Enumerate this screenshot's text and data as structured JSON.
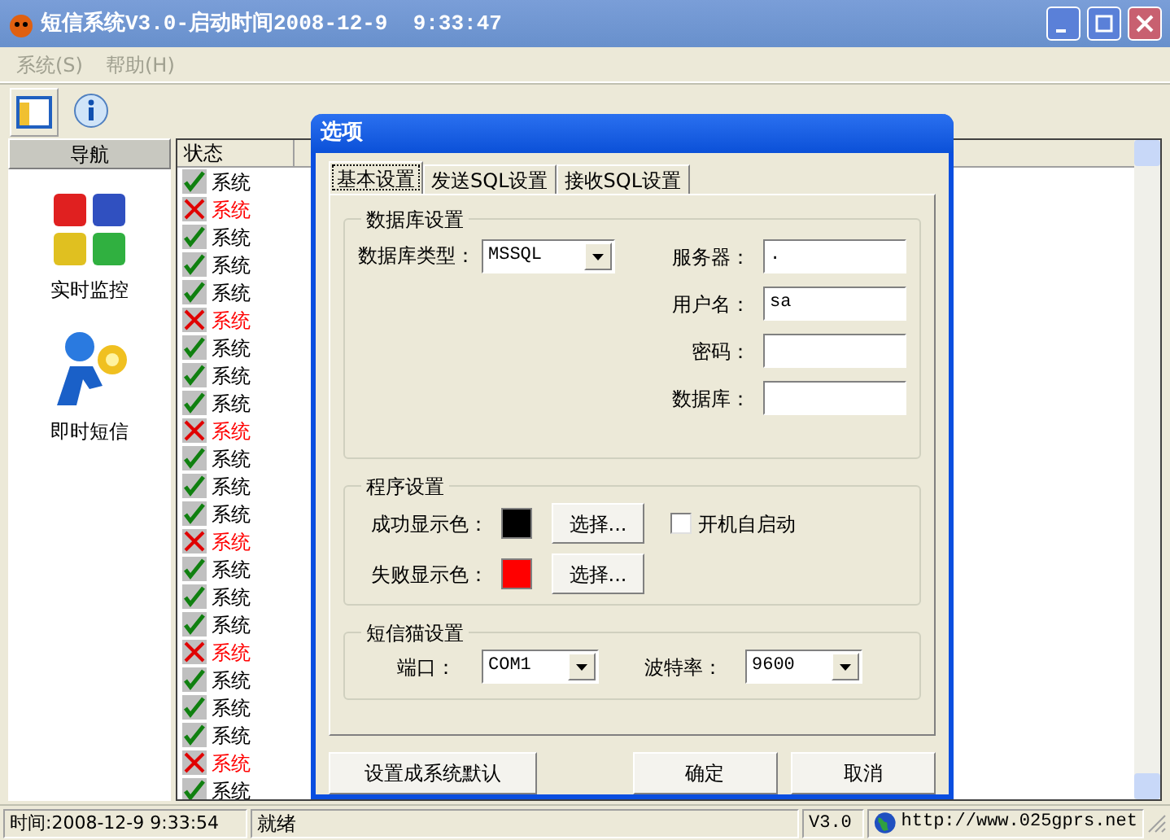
{
  "window": {
    "title": "短信系统V3.0-启动时间2008-12-9  9:33:47"
  },
  "menu": [
    {
      "label": "系统(S)",
      "disabled": true
    },
    {
      "label": "帮助(H)",
      "disabled": true
    }
  ],
  "nav": {
    "title": "导航",
    "items": [
      {
        "label": "实时监控",
        "kind": "monitor"
      },
      {
        "label": "即时短信",
        "kind": "message"
      }
    ]
  },
  "log": {
    "columns": [
      "状态"
    ],
    "rows": [
      {
        "failed": false,
        "text": "系统"
      },
      {
        "failed": true,
        "text": "系统"
      },
      {
        "failed": false,
        "text": "系统"
      },
      {
        "failed": false,
        "text": "系统"
      },
      {
        "failed": false,
        "text": "系统"
      },
      {
        "failed": true,
        "text": "系统"
      },
      {
        "failed": false,
        "text": "系统"
      },
      {
        "failed": false,
        "text": "系统"
      },
      {
        "failed": false,
        "text": "系统"
      },
      {
        "failed": true,
        "text": "系统"
      },
      {
        "failed": false,
        "text": "系统"
      },
      {
        "failed": false,
        "text": "系统"
      },
      {
        "failed": false,
        "text": "系统"
      },
      {
        "failed": true,
        "text": "系统"
      },
      {
        "failed": false,
        "text": "系统"
      },
      {
        "failed": false,
        "text": "系统"
      },
      {
        "failed": false,
        "text": "系统"
      },
      {
        "failed": true,
        "text": "系统"
      },
      {
        "failed": false,
        "text": "系统"
      },
      {
        "failed": false,
        "text": "系统"
      },
      {
        "failed": false,
        "text": "系统"
      },
      {
        "failed": true,
        "text": "系统"
      },
      {
        "failed": false,
        "text": "系统"
      }
    ]
  },
  "dialog": {
    "title": "选项",
    "tabs": [
      {
        "label": "基本设置",
        "selected": true
      },
      {
        "label": "发送SQL设置",
        "selected": false
      },
      {
        "label": "接收SQL设置",
        "selected": false
      }
    ],
    "database": {
      "title": "数据库设置",
      "type_label": "数据库类型：",
      "type_value": "MSSQL",
      "fields": [
        {
          "label": "服务器：",
          "value": "."
        },
        {
          "label": "用户名：",
          "value": "sa"
        },
        {
          "label": "密码："
        },
        {
          "label": "数据库："
        }
      ]
    },
    "program": {
      "title": "程序设置",
      "colors": [
        {
          "label": "成功显示色：",
          "color": "#000000",
          "button": "选择..."
        },
        {
          "label": "失败显示色：",
          "color": "#ff0000",
          "button": "选择..."
        }
      ],
      "autostart": {
        "label": "开机自启动",
        "checked": false
      }
    },
    "modem": {
      "title": "短信猫设置",
      "port_label": "端口：",
      "port_value": "COM1",
      "baud_label": "波特率：",
      "baud_value": "9600"
    },
    "buttons": [
      "设置成系统默认",
      "确定",
      "取消"
    ]
  },
  "status_bar": {
    "time": "时间:2008-12-9 9:33:54",
    "state": "就绪",
    "version": "V3.0",
    "url": "http://www.025gprs.net"
  }
}
